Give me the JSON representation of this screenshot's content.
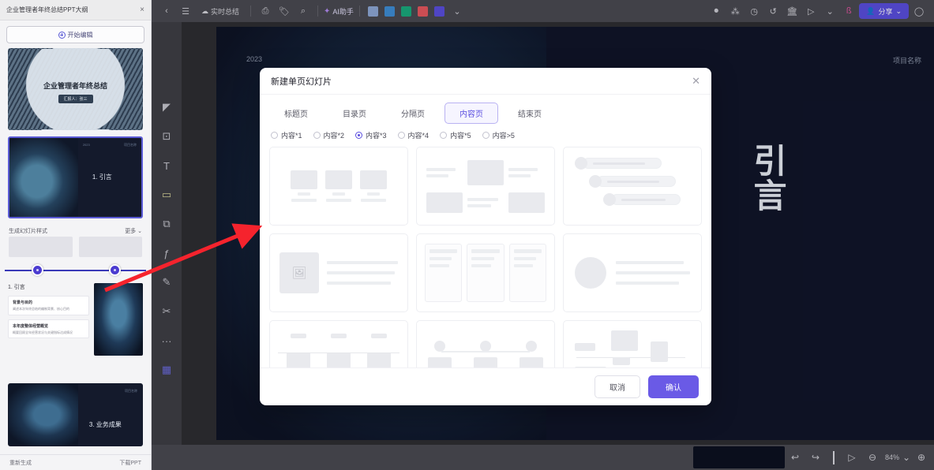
{
  "browser_panel": {
    "tab_title": "企业管理者年终总结PPT大纲",
    "tab_close_icon": "close-icon",
    "new_chat_button": "开始编辑",
    "slides": [
      {
        "title": "企业管理者年终总结",
        "subtitle": "汇报人：张三",
        "tag": "",
        "selected": false
      },
      {
        "number": "1. 引言",
        "tag_left": "2023",
        "tag_right": "项目名称",
        "selected": true
      },
      {
        "number": "3. 业务成果",
        "tag_right": "项目名称",
        "selected": false
      }
    ],
    "section_header": {
      "label": "生成幻灯片样式",
      "more": "更多 ⌄"
    },
    "slider": {
      "left_handle_pct": 19,
      "right_handle_pct": 74
    },
    "detail": {
      "title": "1. 引言",
      "cards": [
        {
          "head": "背景与目的",
          "body": "阐述本次年终总结的编制背景、核心目的"
        },
        {
          "head": "本年度整体经营概览",
          "body": "概要回顾全年经营状况与关键指标达成情况"
        }
      ]
    },
    "footer": {
      "left": "重新生成",
      "right": "下载PPT"
    }
  },
  "topbar": {
    "back_icon": "chevron-left-icon",
    "menu_icon": "hamburger-menu-icon",
    "doc_pill": {
      "icon": "cloud-icon",
      "label": "实时总结"
    },
    "save_icon": "save-icon",
    "tag_icon": "tag-icon",
    "search_icon": "search-icon",
    "ai_assistant": {
      "icon": "sparkle-icon",
      "label": "AI助手"
    },
    "color_swatches": [
      "#8fa9d8",
      "#3f8fd8",
      "#1aab7e",
      "#e8585f",
      "#5b4fe0"
    ],
    "more_icon": "chevron-down-icon",
    "right_icons": [
      "record-icon",
      "share-nodes-icon",
      "history-icon",
      "undo-history-icon",
      "bank-icon",
      "present-icon",
      "collapse-icon",
      "bookmark-icon"
    ],
    "share_button": {
      "icon": "user-icon",
      "label": "分享",
      "chevron": "⌄",
      "color": "#5b4fe0"
    },
    "avatar_icon": "user-avatar-icon"
  },
  "left_tools": [
    {
      "name": "pointer-icon",
      "glyph": "◤"
    },
    {
      "name": "frame-icon",
      "glyph": "⊡"
    },
    {
      "name": "text-icon",
      "glyph": "T"
    },
    {
      "name": "highlight-icon",
      "glyph": "▱"
    },
    {
      "name": "shapes-icon",
      "glyph": "⧉"
    },
    {
      "name": "formula-icon",
      "glyph": "ƒ"
    },
    {
      "name": "pen-icon",
      "glyph": "✎"
    },
    {
      "name": "cut-icon",
      "glyph": "✂"
    },
    {
      "name": "more-icon",
      "glyph": "···"
    },
    {
      "name": "apps-icon",
      "glyph": "▦"
    }
  ],
  "canvas": {
    "year": "2023",
    "brand": "项目名称",
    "big_text": "引言"
  },
  "bottombar": {
    "undo_icon": "undo-icon",
    "redo_icon": "redo-icon",
    "play_icon": "play-icon",
    "zoom_out_icon": "zoom-out-icon",
    "zoom_level": "84%",
    "zoom_chevron": "⌄",
    "zoom_in_icon": "zoom-in-icon"
  },
  "modal": {
    "title": "新建单页幻灯片",
    "close_icon": "close-icon",
    "tabs": [
      {
        "label": "标题页",
        "active": false
      },
      {
        "label": "目录页",
        "active": false
      },
      {
        "label": "分隔页",
        "active": false
      },
      {
        "label": "内容页",
        "active": true
      },
      {
        "label": "结束页",
        "active": false
      }
    ],
    "radios": [
      {
        "label": "内容*1",
        "selected": false
      },
      {
        "label": "内容*2",
        "selected": false
      },
      {
        "label": "内容*3",
        "selected": true
      },
      {
        "label": "内容*4",
        "selected": false
      },
      {
        "label": "内容*5",
        "selected": false
      },
      {
        "label": "内容>5",
        "selected": false
      }
    ],
    "templates": [
      {
        "name": "three-boxes-with-captions"
      },
      {
        "name": "center-image-side-text"
      },
      {
        "name": "avatar-pill-list"
      },
      {
        "name": "image-left-text-right"
      },
      {
        "name": "three-column-cards"
      },
      {
        "name": "circle-left-text-right"
      },
      {
        "name": "timeline-steps"
      },
      {
        "name": "node-chain-diagram"
      },
      {
        "name": "mixed-blocks-flow"
      }
    ],
    "cancel_button": "取消",
    "confirm_button": "确认",
    "accent_color": "#6a5ae6"
  }
}
